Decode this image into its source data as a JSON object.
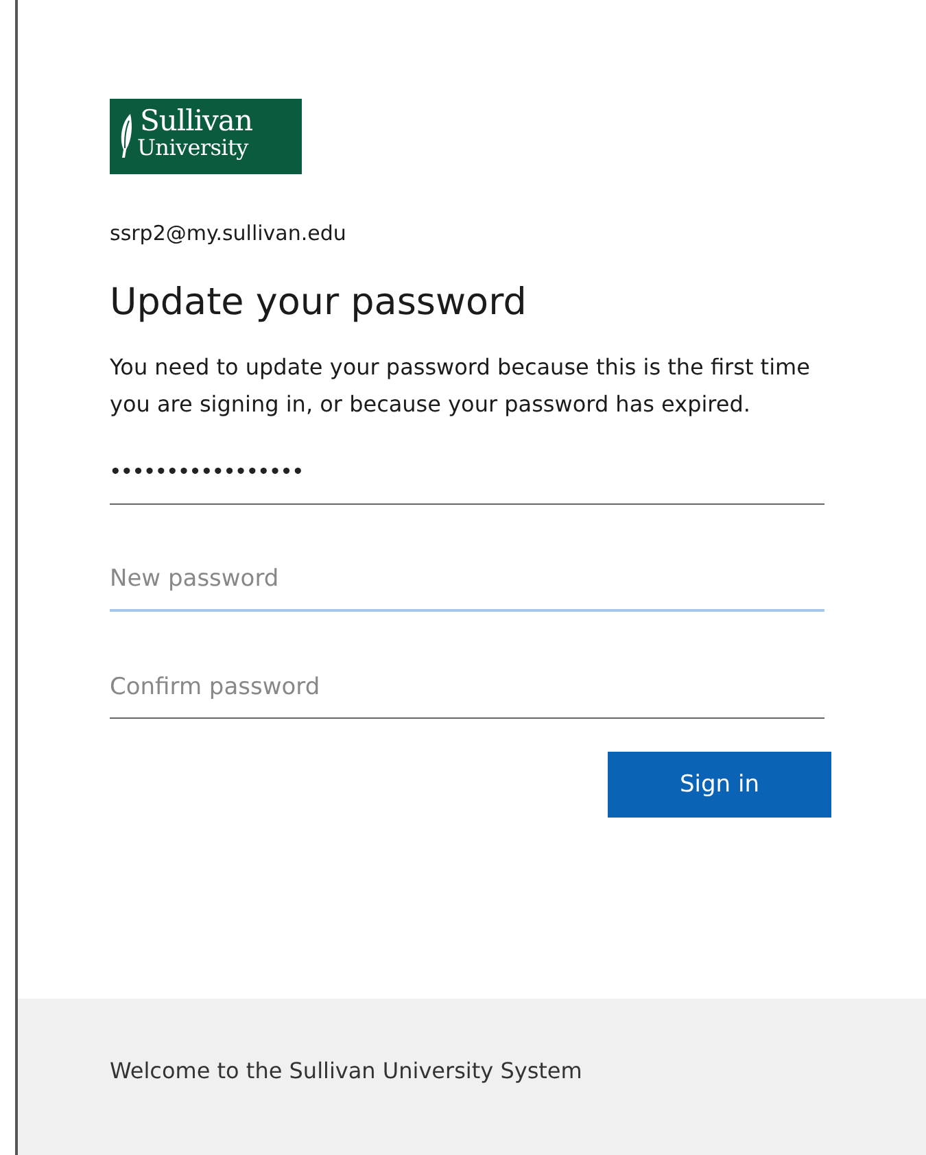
{
  "logo": {
    "line_1": "Sullivan",
    "line_2": "University"
  },
  "account": "ssrp2@my.sullivan.edu",
  "title": "Update your password",
  "message": "You need to update your password because this is the first time you are signing in, or because your password has expired.",
  "fields": [
    {
      "kind": "password",
      "value": "•••••••••••••••••",
      "focused": false
    },
    {
      "kind": "password",
      "placeholder": "New password",
      "focused": true
    },
    {
      "kind": "password",
      "placeholder": "Confirm password",
      "focused": false
    }
  ],
  "button": "Sign in",
  "footer": "Welcome to the Sullivan University System"
}
